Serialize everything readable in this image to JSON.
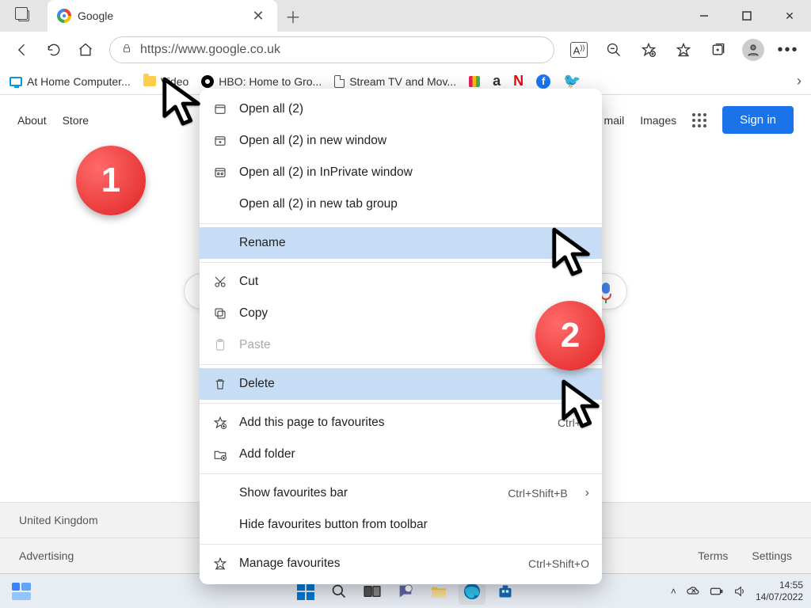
{
  "browser": {
    "tab_title": "Google",
    "url": "https://www.google.co.uk"
  },
  "bookmarks": {
    "home_computer": "At Home Computer...",
    "video": "Video",
    "hbo": "HBO: Home to Gro...",
    "stream": "Stream TV and Mov..."
  },
  "google": {
    "nav_about": "About",
    "nav_store": "Store",
    "nav_gmail": "mail",
    "nav_images": "Images",
    "signin": "Sign in",
    "footer_country": "United Kingdom",
    "footer_advertising": "Advertising",
    "footer_terms": "Terms",
    "footer_settings": "Settings"
  },
  "ctx": {
    "open_all": "Open all (2)",
    "open_all_window": "Open all (2) in new window",
    "open_all_inprivate": "Open all (2) in InPrivate window",
    "open_all_group": "Open all (2) in new tab group",
    "rename": "Rename",
    "cut": "Cut",
    "copy": "Copy",
    "paste": "Paste",
    "delete": "Delete",
    "add_page": "Add this page to favourites",
    "add_page_sc": "Ctrl+D",
    "add_folder": "Add folder",
    "show_bar": "Show favourites bar",
    "show_bar_sc": "Ctrl+Shift+B",
    "hide_button": "Hide favourites button from toolbar",
    "manage": "Manage favourites",
    "manage_sc": "Ctrl+Shift+O"
  },
  "callout": {
    "one": "1",
    "two": "2"
  },
  "taskbar": {
    "time": "14:55",
    "date": "14/07/2022"
  }
}
